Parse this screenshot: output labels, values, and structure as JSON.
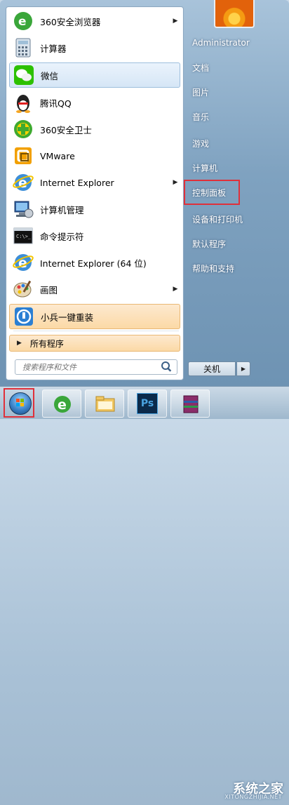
{
  "left_menu": {
    "items": [
      {
        "label": "360安全浏览器",
        "icon": "360-browser-icon",
        "has_arrow": true
      },
      {
        "label": "计算器",
        "icon": "calculator-icon",
        "has_arrow": false
      },
      {
        "label": "微信",
        "icon": "wechat-icon",
        "has_arrow": false
      },
      {
        "label": "腾讯QQ",
        "icon": "qq-penguin-icon",
        "has_arrow": false
      },
      {
        "label": "360安全卫士",
        "icon": "360-guard-icon",
        "has_arrow": false
      },
      {
        "label": "VMware",
        "icon": "vmware-icon",
        "has_arrow": false
      },
      {
        "label": "Internet Explorer",
        "icon": "ie-icon",
        "has_arrow": true
      },
      {
        "label": "计算机管理",
        "icon": "computer-management-icon",
        "has_arrow": false
      },
      {
        "label": "命令提示符",
        "icon": "cmd-icon",
        "has_arrow": false
      },
      {
        "label": "Internet Explorer (64 位)",
        "icon": "ie-icon",
        "has_arrow": false
      },
      {
        "label": "画图",
        "icon": "paint-icon",
        "has_arrow": true
      },
      {
        "label": "小兵一键重装",
        "icon": "reinstall-tool-icon",
        "has_arrow": false
      }
    ],
    "all_programs": "所有程序",
    "search_placeholder": "搜索程序和文件"
  },
  "right_menu": {
    "items": [
      {
        "label": "Administrator"
      },
      {
        "label": "文档"
      },
      {
        "label": "图片"
      },
      {
        "label": "音乐"
      },
      {
        "label": "游戏"
      },
      {
        "label": "计算机"
      },
      {
        "label": "控制面板"
      },
      {
        "label": "设备和打印机"
      },
      {
        "label": "默认程序"
      },
      {
        "label": "帮助和支持"
      }
    ],
    "shutdown_label": "关机"
  },
  "taskbar": {
    "buttons": [
      "start-orb",
      "ie-taskbar",
      "explorer-taskbar",
      "photoshop-taskbar",
      "winrar-taskbar"
    ],
    "photoshop_text": "Ps"
  },
  "watermark": {
    "text": "系统之家",
    "sub": "XITONGZHIJIA.NET"
  },
  "colors": {
    "highlight_red": "#e0303a",
    "hover_blue": "#d6e6f6",
    "hover_orange": "#fbd9a6"
  }
}
